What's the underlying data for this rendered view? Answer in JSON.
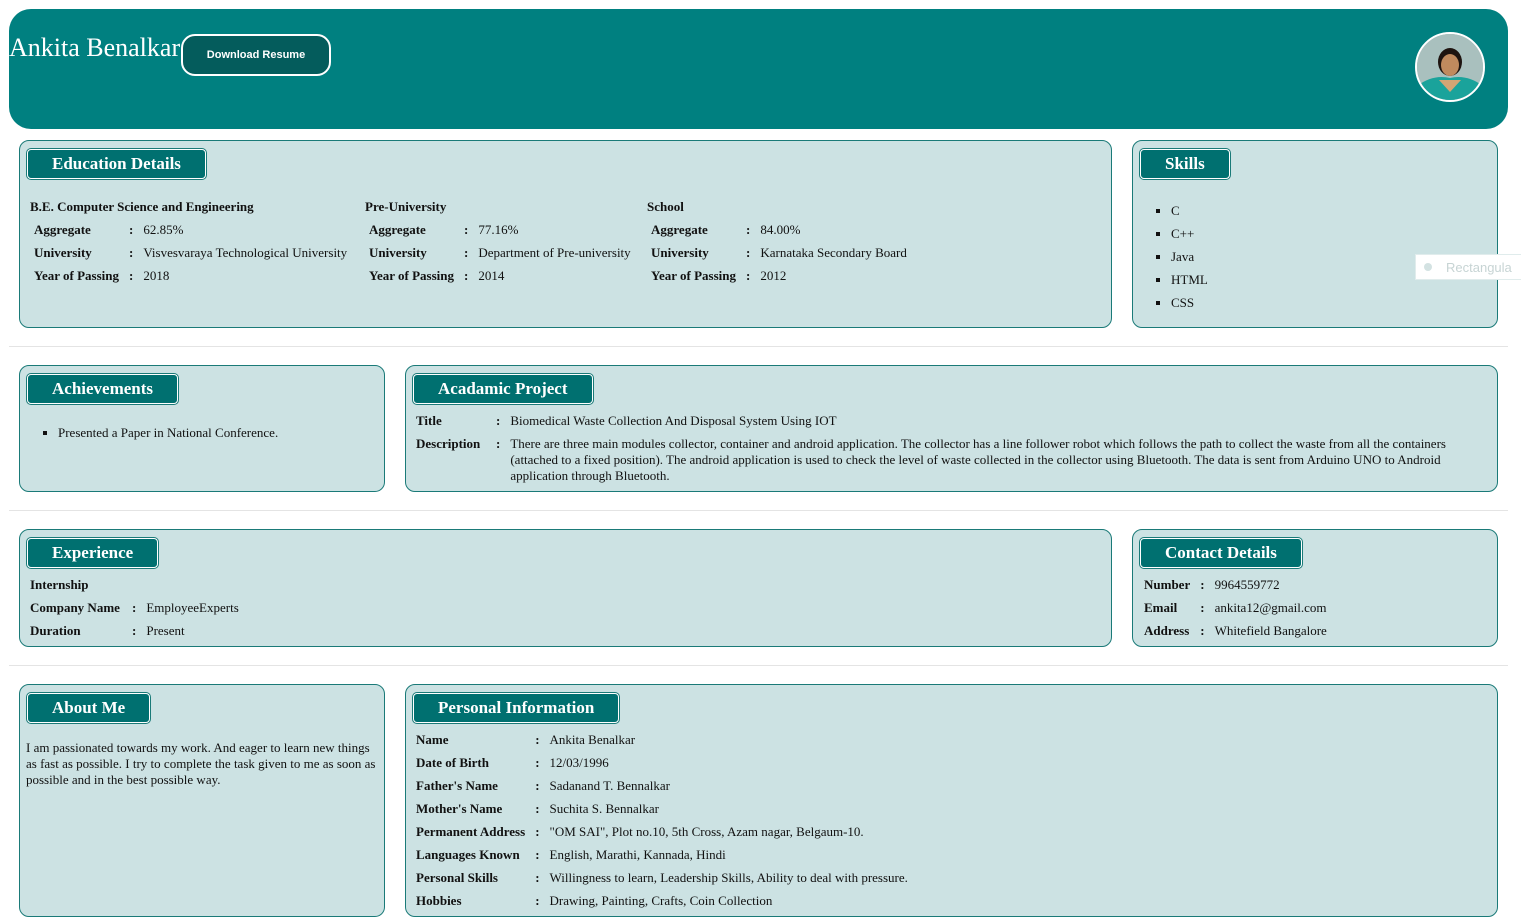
{
  "header": {
    "name": "Ankita Benalkar",
    "download_label": "Download Resume",
    "avatar_icon": "profile-photo"
  },
  "education": {
    "title": "Education Details",
    "columns": [
      {
        "heading": "B.E. Computer Science and Engineering",
        "rows": [
          {
            "k": "Aggregate",
            "v": "62.85%"
          },
          {
            "k": "University",
            "v": "Visvesvaraya Technological University"
          },
          {
            "k": "Year of Passing",
            "v": "2018"
          }
        ]
      },
      {
        "heading": "Pre-University",
        "rows": [
          {
            "k": "Aggregate",
            "v": "77.16%"
          },
          {
            "k": "University",
            "v": "Department of Pre-university"
          },
          {
            "k": "Year of Passing",
            "v": "2014"
          }
        ]
      },
      {
        "heading": "School",
        "rows": [
          {
            "k": "Aggregate",
            "v": "84.00%"
          },
          {
            "k": "University",
            "v": "Karnataka Secondary Board"
          },
          {
            "k": "Year of Passing",
            "v": "2012"
          }
        ]
      }
    ]
  },
  "skills": {
    "title": "Skills",
    "items": [
      "C",
      "C++",
      "Java",
      "HTML",
      "CSS"
    ]
  },
  "overlay": {
    "label": "Rectangula"
  },
  "achievements": {
    "title": "Achievements",
    "items": [
      "Presented a Paper in National Conference."
    ]
  },
  "project": {
    "title": "Acadamic Project",
    "rows": [
      {
        "k": "Title",
        "v": "Biomedical Waste Collection And Disposal System Using IOT"
      },
      {
        "k": "Description",
        "v": "There are three main modules collector, container and android application. The collector has a line follower robot which follows the path to collect the waste from all the containers (attached to a fixed position). The android application is used to check the level of waste collected in the collector using Bluetooth. The data is sent from Arduino UNO to Android application through Bluetooth."
      }
    ]
  },
  "experience": {
    "title": "Experience",
    "subheading": "Internship",
    "rows": [
      {
        "k": "Company Name",
        "v": "EmployeeExperts"
      },
      {
        "k": "Duration",
        "v": "Present"
      }
    ]
  },
  "contact": {
    "title": "Contact Details",
    "rows": [
      {
        "k": "Number",
        "v": "9964559772"
      },
      {
        "k": "Email",
        "v": "ankita12@gmail.com"
      },
      {
        "k": "Address",
        "v": "Whitefield Bangalore"
      }
    ]
  },
  "about": {
    "title": "About Me",
    "text": "I am passionated towards my work. And eager to learn new things as fast as possible. I try to complete the task given to me as soon as possible and in the best possible way."
  },
  "personal": {
    "title": "Personal Information",
    "rows": [
      {
        "k": "Name",
        "v": "Ankita Benalkar"
      },
      {
        "k": "Date of Birth",
        "v": "12/03/1996"
      },
      {
        "k": "Father's Name",
        "v": "Sadanand T. Bennalkar"
      },
      {
        "k": "Mother's Name",
        "v": "Suchita S. Bennalkar"
      },
      {
        "k": "Permanent Address",
        "v": "\"OM SAI\", Plot no.10, 5th Cross, Azam nagar, Belgaum-10."
      },
      {
        "k": "Languages Known",
        "v": "English, Marathi, Kannada, Hindi"
      },
      {
        "k": "Personal Skills",
        "v": "Willingness to learn, Leadership Skills, Ability to deal with pressure."
      },
      {
        "k": "Hobbies",
        "v": "Drawing, Painting, Crafts, Coin Collection"
      }
    ]
  }
}
